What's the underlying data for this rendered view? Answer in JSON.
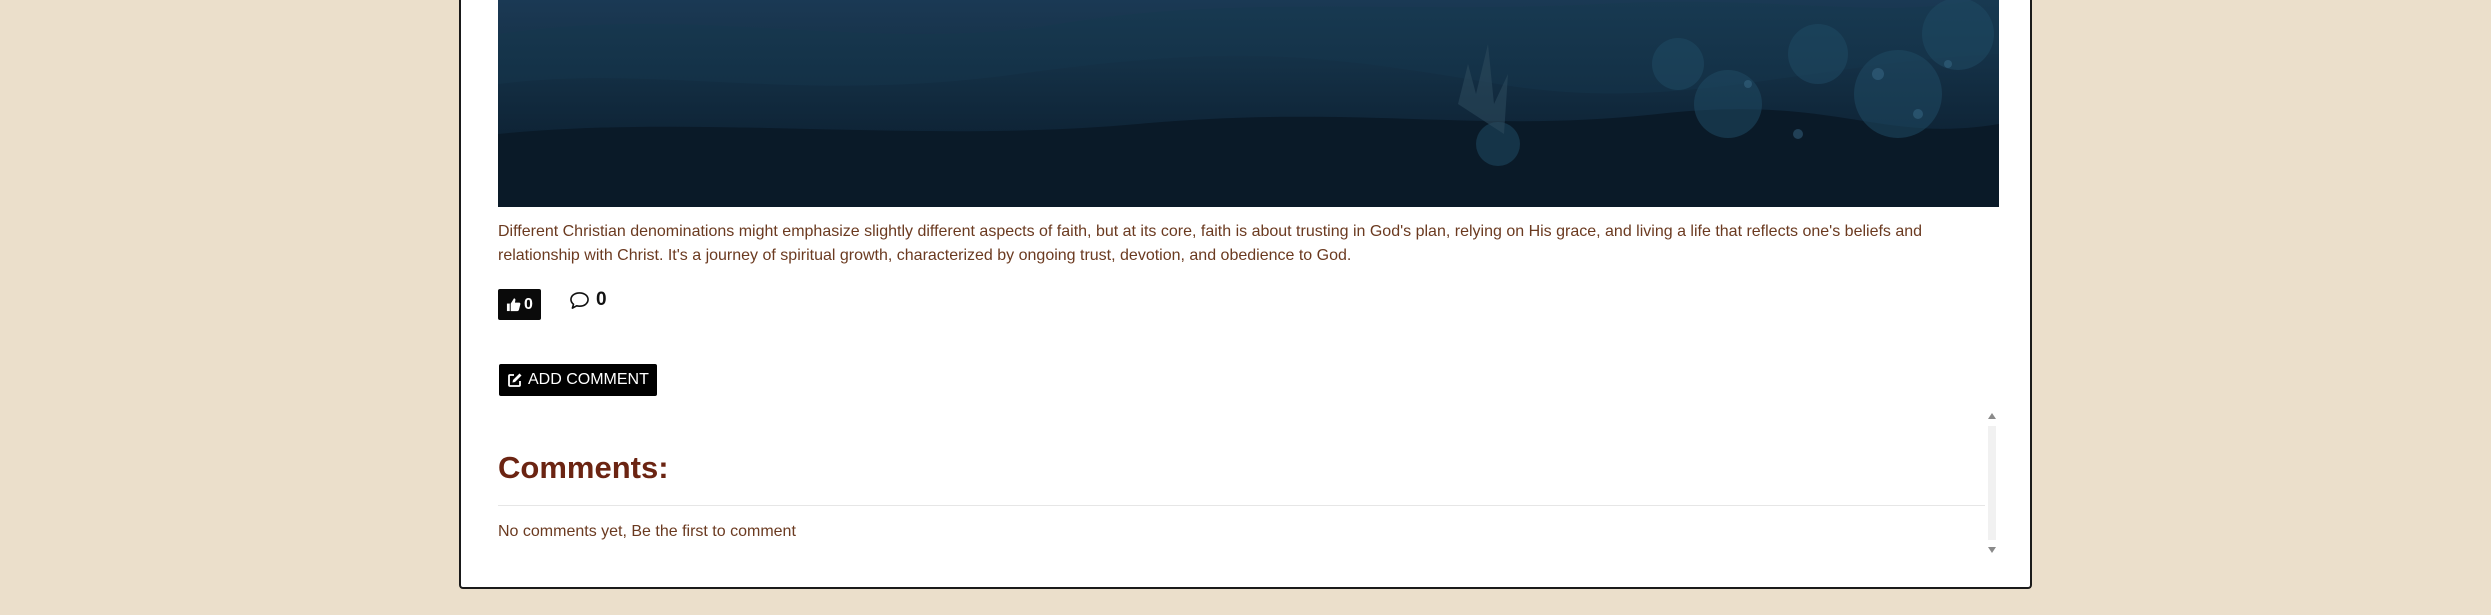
{
  "post": {
    "body": "Different Christian denominations might emphasize slightly different aspects of faith, but at its core, faith is about trusting in God's plan, relying on His grace, and living a life that reflects one's beliefs and relationship with Christ. It's a journey of spiritual growth, characterized by ongoing trust, devotion, and obedience to God.",
    "like_count": "0",
    "comment_count": "0"
  },
  "actions": {
    "add_comment_label": "ADD COMMENT"
  },
  "comments": {
    "heading": "Comments:",
    "empty_message": "No comments yet, Be the first to comment"
  },
  "icons": {
    "like": "thumbs-up-icon",
    "comment": "comment-bubble-icon",
    "edit": "edit-square-icon"
  },
  "colors": {
    "page_background": "#ebdfcb",
    "text_brown": "#6b3a20",
    "heading_brown": "#6b2412",
    "button_black": "#000000"
  }
}
